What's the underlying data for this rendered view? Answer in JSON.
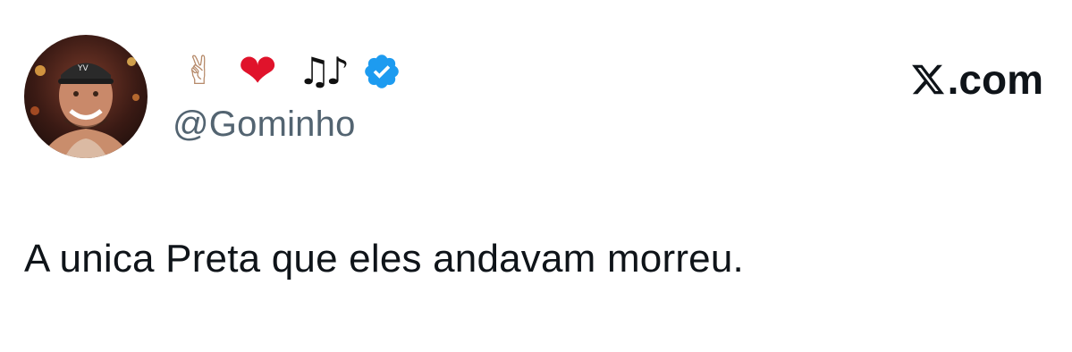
{
  "author": {
    "display_name_emojis": [
      {
        "name": "victory-hand-emoji",
        "glyph": "✌"
      },
      {
        "name": "red-heart-emoji",
        "glyph": "❤"
      },
      {
        "name": "musical-notes-emoji",
        "glyph": "♫♪"
      }
    ],
    "verified": true,
    "handle": "@Gominho",
    "avatar": "profile-photo"
  },
  "brand": {
    "text": ".com",
    "logo": "x-logo-icon"
  },
  "tweet": {
    "text": "A unica Preta que eles andavam morreu."
  },
  "colors": {
    "text_primary": "#0f1419",
    "text_secondary": "#536471",
    "verified_blue": "#1d9bf0",
    "heart_red": "#e0132b",
    "background": "#ffffff"
  }
}
